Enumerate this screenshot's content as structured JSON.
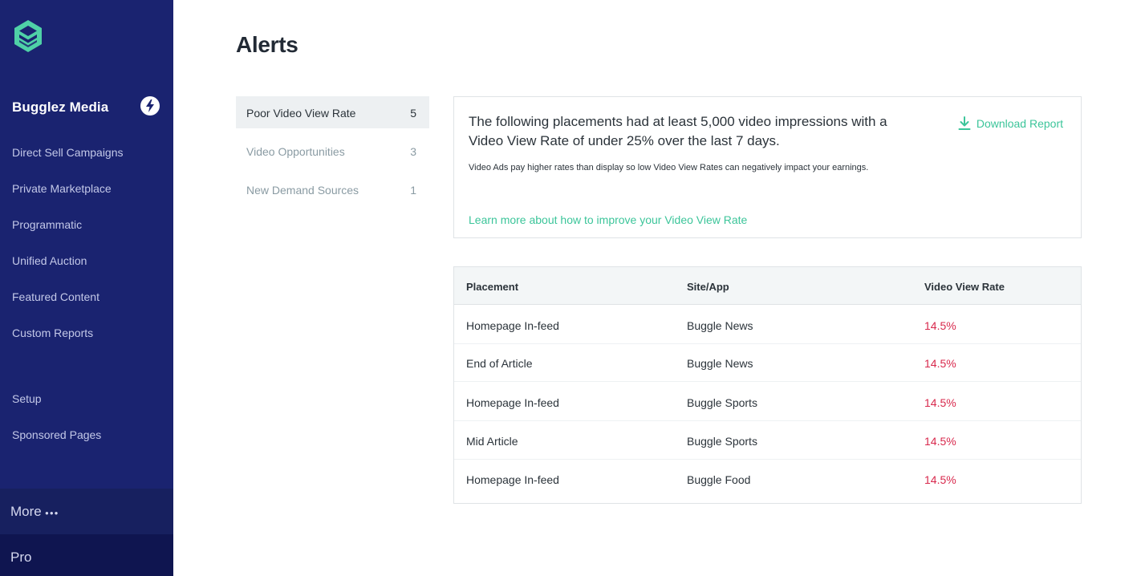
{
  "sidebar": {
    "brand_name": "Bugglez Media",
    "items": [
      {
        "label": "Direct Sell Campaigns"
      },
      {
        "label": "Private Marketplace"
      },
      {
        "label": "Programmatic"
      },
      {
        "label": "Unified Auction"
      },
      {
        "label": "Featured Content"
      },
      {
        "label": "Custom Reports"
      },
      {
        "label": "Setup"
      },
      {
        "label": "Sponsored Pages"
      }
    ],
    "more_label": "More",
    "more_dots": "●●●",
    "pro_label": "Pro"
  },
  "page": {
    "title": "Alerts"
  },
  "alerts": [
    {
      "label": "Poor Video View Rate",
      "count": "5"
    },
    {
      "label": "Video Opportunities",
      "count": "3"
    },
    {
      "label": "New Demand Sources",
      "count": "1"
    }
  ],
  "info": {
    "headline": "The following placements had at least 5,000 video impressions with a Video View Rate of under 25% over the last 7 days.",
    "sub": "Video Ads pay higher rates than display so low Video View Rates can negatively impact your earnings.",
    "learn_link": "Learn more about how to improve your Video View Rate",
    "download_label": "Download Report"
  },
  "table": {
    "headers": [
      "Placement",
      "Site/App",
      "Video View Rate"
    ],
    "rows": [
      [
        "Homepage In-feed",
        "Buggle News",
        "14.5%"
      ],
      [
        "End of Article",
        "Buggle News",
        "14.5%"
      ],
      [
        "Homepage In-feed",
        "Buggle Sports",
        "14.5%"
      ],
      [
        "Mid Article",
        "Buggle Sports",
        "14.5%"
      ],
      [
        "Homepage In-feed",
        "Buggle Food",
        "14.5%"
      ]
    ]
  },
  "colors": {
    "sidebar_bg": "#1a2370",
    "accent_green": "#3cc59a",
    "rate_red": "#d8294d",
    "logo_teal": "#4fd1a7"
  },
  "icons": {
    "logo": "bugglez-logo-icon",
    "brand_action": "lightning-bolt-icon",
    "download": "download-icon"
  }
}
